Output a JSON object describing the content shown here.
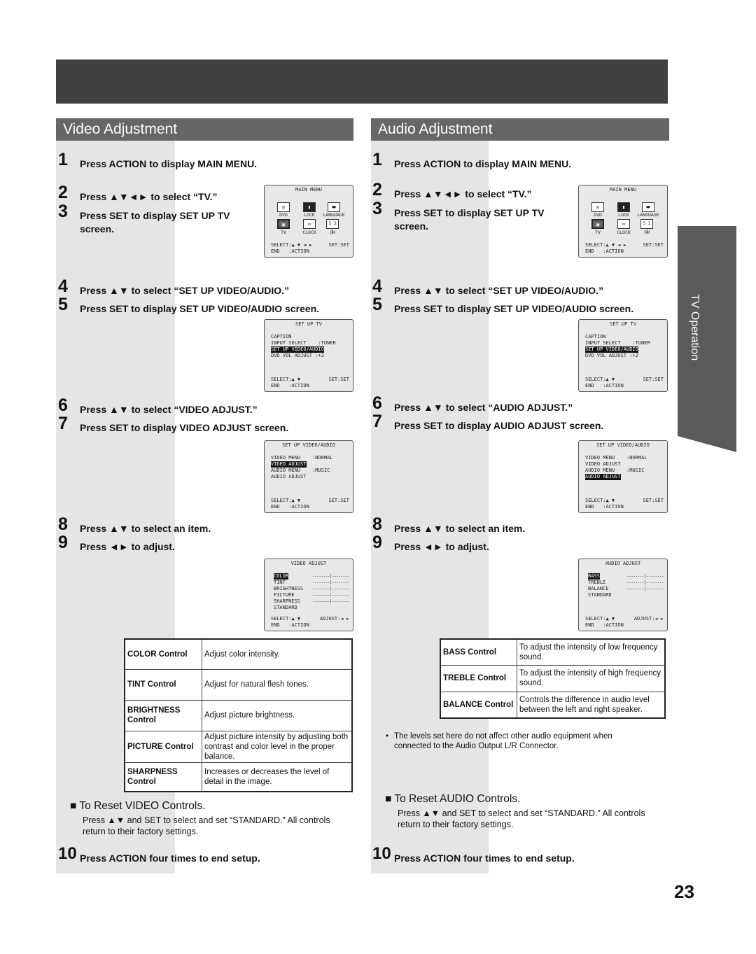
{
  "page_number": "23",
  "side_tab": "TV Operation",
  "video": {
    "title": "Video Adjustment",
    "steps": [
      {
        "n": "1",
        "text": "Press ACTION to display MAIN MENU."
      },
      {
        "n": "2",
        "text": "Press ▲▼◄► to select “TV.”"
      },
      {
        "n": "3",
        "text": "Press SET to display SET UP TV",
        "text2": "screen."
      },
      {
        "n": "4",
        "text": "Press ▲▼ to select “SET UP VIDEO/AUDIO.”"
      },
      {
        "n": "5",
        "text": "Press SET to display SET UP VIDEO/AUDIO screen."
      },
      {
        "n": "6",
        "text": "Press ▲▼ to select “VIDEO ADJUST.”"
      },
      {
        "n": "7",
        "text": "Press SET to display VIDEO ADJUST screen."
      },
      {
        "n": "8",
        "text": "Press ▲▼ to select an item."
      },
      {
        "n": "9",
        "text": "Press ◄► to adjust."
      },
      {
        "n": "10",
        "text": "Press ACTION four times to end setup."
      }
    ],
    "setup_va_selected": "VIDEO ADJUST",
    "adjust_screen": {
      "title": "VIDEO ADJUST",
      "items": [
        "COLOR",
        "TINT",
        "BRIGHTNESS",
        "PICTURE",
        "SHARPNESS",
        "STANDARD"
      ],
      "selected": "COLOR"
    },
    "table": [
      {
        "name": "COLOR Control",
        "desc": "Adjust color intensity."
      },
      {
        "name": "TINT Control",
        "desc": "Adjust for natural flesh tones."
      },
      {
        "name": "BRIGHTNESS Control",
        "desc": "Adjust picture brightness."
      },
      {
        "name": "PICTURE Control",
        "desc": "Adjust picture intensity by adjusting both contrast and color level in the proper balance."
      },
      {
        "name": "SHARPNESS Control",
        "desc": "Increases or decreases the level of detail in the image."
      }
    ],
    "reset": {
      "heading": "To Reset VIDEO Controls.",
      "body": "Press ▲▼ and SET to select and set “STANDARD.” All controls return to their factory settings."
    }
  },
  "audio": {
    "title": "Audio Adjustment",
    "steps": [
      {
        "n": "1",
        "text": "Press ACTION to display MAIN MENU."
      },
      {
        "n": "2",
        "text": "Press ▲▼◄► to select “TV.”"
      },
      {
        "n": "3",
        "text": "Press SET to display SET UP TV",
        "text2": "screen."
      },
      {
        "n": "4",
        "text": "Press ▲▼ to select “SET UP VIDEO/AUDIO.”"
      },
      {
        "n": "5",
        "text": "Press SET to display SET UP VIDEO/AUDIO screen."
      },
      {
        "n": "6",
        "text": "Press ▲▼ to select “AUDIO ADJUST.”"
      },
      {
        "n": "7",
        "text": "Press SET to display AUDIO ADJUST screen."
      },
      {
        "n": "8",
        "text": "Press ▲▼ to select an item."
      },
      {
        "n": "9",
        "text": "Press ◄► to adjust."
      },
      {
        "n": "10",
        "text": "Press ACTION four times to end setup."
      }
    ],
    "setup_va_selected": "AUDIO ADJUST",
    "adjust_screen": {
      "title": "AUDIO ADJUST",
      "items": [
        "BASS",
        "TREBLE",
        "BALANCE",
        "STANDARD"
      ],
      "selected": "BASS"
    },
    "table": [
      {
        "name": "BASS Control",
        "desc": "To adjust the intensity of low frequency sound."
      },
      {
        "name": "TREBLE Control",
        "desc": "To adjust the intensity of high frequency sound."
      },
      {
        "name": "BALANCE Control",
        "desc": "Controls the difference in audio level between the left and right speaker."
      }
    ],
    "note": "The levels set here do not affect other audio equipment when connected to the Audio Output L/R Connector.",
    "reset": {
      "heading": "To Reset AUDIO Controls.",
      "body": "Press ▲▼ and SET to select and set “STANDARD.” All controls return to their factory settings."
    }
  },
  "screens": {
    "main_menu": {
      "title": "MAIN MENU",
      "icons": [
        {
          "label": "DVD",
          "icon": "disc-icon"
        },
        {
          "label": "LOCK",
          "icon": "lock-icon"
        },
        {
          "label": "LANGUAGE",
          "icon": "lips-icon"
        },
        {
          "label": "TV",
          "icon": "tv-icon"
        },
        {
          "label": "CLOCK",
          "icon": "clock-icon"
        },
        {
          "label": "CH",
          "icon": "channel-icon",
          "glyph": "5 3 1"
        }
      ],
      "selected": "TV",
      "footer_select": "SELECT:▲ ▼ ◄ ►",
      "footer_set": "SET:SET",
      "footer_end": "END   :ACTION"
    },
    "setup_tv": {
      "title": "SET UP TV",
      "lines": [
        "CAPTION",
        "INPUT SELECT    :TUNER",
        "SET UP VIDEO/AUDIO",
        "DVD VOL ADJUST :+2"
      ],
      "selected_index": 2,
      "footer_select": "SELECT:▲ ▼",
      "footer_set": "SET:SET",
      "footer_end": "END   :ACTION"
    },
    "setup_va": {
      "title": "SET UP VIDEO/AUDIO",
      "lines": [
        "VIDEO MENU    :NORMAL",
        "VIDEO ADJUST",
        "AUDIO MENU    :MUSIC",
        "AUDIO ADJUST"
      ],
      "footer_select": "SELECT:▲ ▼",
      "footer_set": "SET:SET",
      "footer_end": "END   :ACTION"
    },
    "adjust_footer_select": "SELECT:▲ ▼",
    "adjust_footer_adjust": "ADJUST:◄ ►",
    "adjust_footer_end": "END   :ACTION",
    "slider_glyph": "--------|--------"
  }
}
